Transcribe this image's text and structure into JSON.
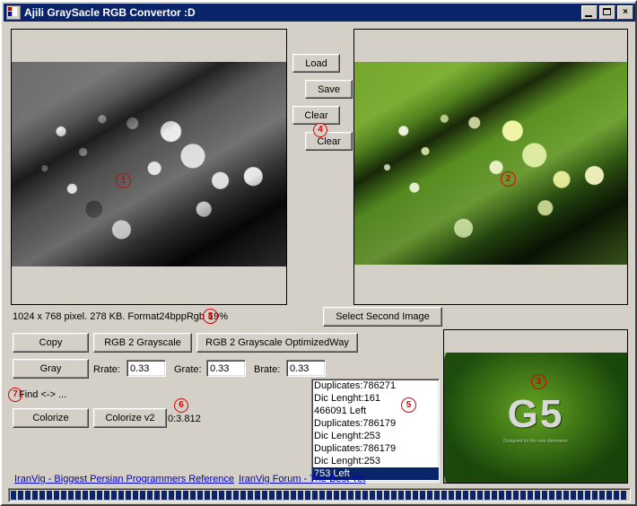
{
  "window": {
    "title": "Ajili GraySacle RGB Convertor :D",
    "icon": "app-icon",
    "minimize": "_",
    "maximize": "□",
    "close": "×"
  },
  "colors": {
    "face": "#d4d0c8",
    "titlebar": "#0a246a",
    "selection": "#0a246a",
    "marker": "#e00000",
    "link": "#0000cc"
  },
  "images": {
    "source": {
      "name": "grayscale-leaves-preview",
      "marker": "1",
      "description": "Grayscale photo of leaves with water droplets"
    },
    "result": {
      "name": "green-leaves-preview",
      "marker": "2",
      "description": "Green colorized photo of leaves with water droplets"
    },
    "second": {
      "name": "g5-leaf-preview",
      "marker": "3",
      "logo": "G5",
      "tagline": "Designed for the new dimension"
    }
  },
  "buttons": {
    "load": "Load",
    "save": "Save",
    "clear1": "Clear",
    "clear2": "Clear",
    "clear_marker": "4",
    "select_second_image": "Select Second Image",
    "copy": "Copy",
    "rgb2grayscale": "RGB 2 Grayscale",
    "rgb2grayscale_optimized": "RGB 2 Grayscale OptimizedWay",
    "gray": "Gray",
    "colorize": "Colorize",
    "colorize_v2": "Colorize v2"
  },
  "status": {
    "image_info": "1024 x 768 pixel.  278 KB.  Format24bppRgb",
    "percent": "19%",
    "percent_marker": "8",
    "elapsed": "0:3.812",
    "elapsed_marker": "6"
  },
  "rates": {
    "r_label": "Rrate:",
    "r_value": "0.33",
    "g_label": "Grate:",
    "g_value": "0.33",
    "b_label": "Brate:",
    "b_value": "0.33"
  },
  "find": {
    "label": "Find <-> ...",
    "marker": "7"
  },
  "log": {
    "marker": "5",
    "items": [
      {
        "text": "Duplicates:786271",
        "selected": false
      },
      {
        "text": "Dic Lenght:161",
        "selected": false
      },
      {
        "text": "466091 Left",
        "selected": false
      },
      {
        "text": "Duplicates:786179",
        "selected": false
      },
      {
        "text": "Dic Lenght:253",
        "selected": false
      },
      {
        "text": "Duplicates:786179",
        "selected": false
      },
      {
        "text": "Dic Lenght:253",
        "selected": false
      },
      {
        "text": "753 Left",
        "selected": true
      }
    ]
  },
  "links": {
    "site": "IranVig  -  Biggest  Persian  Programmers  Reference",
    "forum": "IranVig Forum - The Best Yet"
  },
  "progress": {
    "value": "100"
  }
}
